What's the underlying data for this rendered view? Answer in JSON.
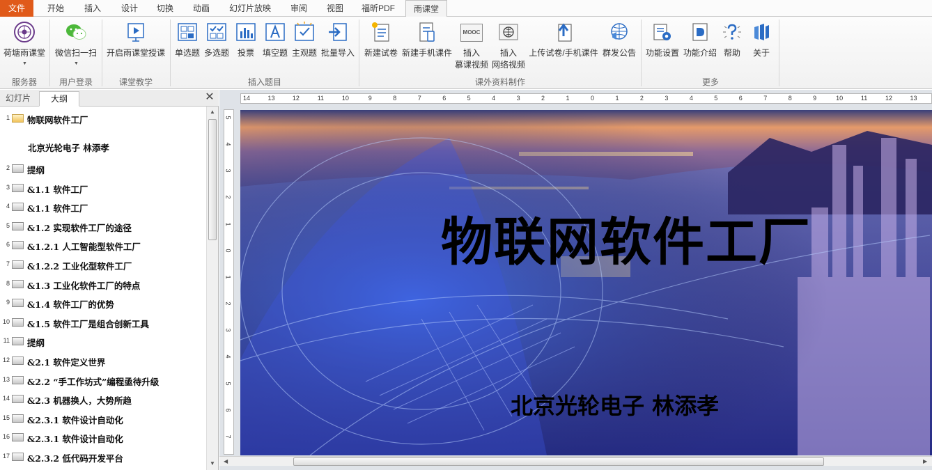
{
  "ribbon_tabs": [
    "文件",
    "开始",
    "插入",
    "设计",
    "切换",
    "动画",
    "幻灯片放映",
    "审阅",
    "视图",
    "福昕PDF",
    "雨课堂"
  ],
  "active_tab": "雨课堂",
  "groups": {
    "server": {
      "label": "服务器",
      "btn": "荷塘雨课堂"
    },
    "login": {
      "label": "用户登录",
      "btn": "微信扫一扫"
    },
    "teach": {
      "label": "课堂教学",
      "btn": "开启雨课堂授课"
    },
    "insert": {
      "label": "插入题目",
      "btns": [
        "单选题",
        "多选题",
        "投票",
        "填空题",
        "主观题",
        "批量导入"
      ]
    },
    "extra": {
      "label": "课外资料制作",
      "btns": [
        "新建试卷",
        "新建手机课件",
        "上传试卷/手机课件",
        "群发公告"
      ],
      "mooc": [
        "插入",
        "慕课视频"
      ],
      "web": [
        "插入",
        "网络视频"
      ],
      "mooc_badge": "MOOC"
    },
    "more": {
      "label": "更多",
      "btns": [
        "功能设置",
        "功能介绍",
        "帮助",
        "关于"
      ]
    }
  },
  "panel": {
    "tabs": [
      "幻灯片",
      "大纲"
    ],
    "active": "大纲",
    "close": "✕"
  },
  "outline": [
    {
      "num": "1",
      "text": "物联网软件工厂",
      "sub": "北京光轮电子  林添孝"
    },
    {
      "num": "2",
      "text": "提纲"
    },
    {
      "num": "3",
      "text": "&1.1 软件工厂"
    },
    {
      "num": "4",
      "text": "&1.1 软件工厂"
    },
    {
      "num": "5",
      "text": "&1.2 实现软件工厂的途径"
    },
    {
      "num": "6",
      "text": "&1.2.1 人工智能型软件工厂"
    },
    {
      "num": "7",
      "text": "&1.2.2 工业化型软件工厂"
    },
    {
      "num": "8",
      "text": "&1.3 工业化软件工厂的特点"
    },
    {
      "num": "9",
      "text": "&1.4 软件工厂的优势"
    },
    {
      "num": "10",
      "text": "&1.5 软件工厂是组合创新工具"
    },
    {
      "num": "11",
      "text": "提纲"
    },
    {
      "num": "12",
      "text": "&2.1 软件定义世界"
    },
    {
      "num": "13",
      "text": "&2.2 “手工作坊式”编程亟待升级"
    },
    {
      "num": "14",
      "text": "&2.3 机器换人，大势所趋"
    },
    {
      "num": "15",
      "text": "&2.3.1 软件设计自动化"
    },
    {
      "num": "16",
      "text": "&2.3.1 软件设计自动化"
    },
    {
      "num": "17",
      "text": "&2.3.2 低代码开发平台"
    }
  ],
  "ruler": {
    "h": [
      "14",
      "13",
      "12",
      "11",
      "10",
      "9",
      "8",
      "7",
      "6",
      "5",
      "4",
      "3",
      "2",
      "1",
      "0",
      "1",
      "2",
      "3",
      "4",
      "5",
      "6",
      "7",
      "8",
      "9",
      "10",
      "11",
      "12",
      "13"
    ],
    "v": [
      "5",
      "4",
      "3",
      "2",
      "1",
      "0",
      "1",
      "2",
      "3",
      "4",
      "5",
      "6",
      "7"
    ]
  },
  "slide": {
    "title": "物联网软件工厂",
    "subtitle": "北京光轮电子   林添孝"
  },
  "colors": {
    "file_tab": "#e05a1a",
    "accent_blue": "#2b6cc4",
    "sky_top": "#e59a6a",
    "city_blue": "#2a2f8c"
  }
}
